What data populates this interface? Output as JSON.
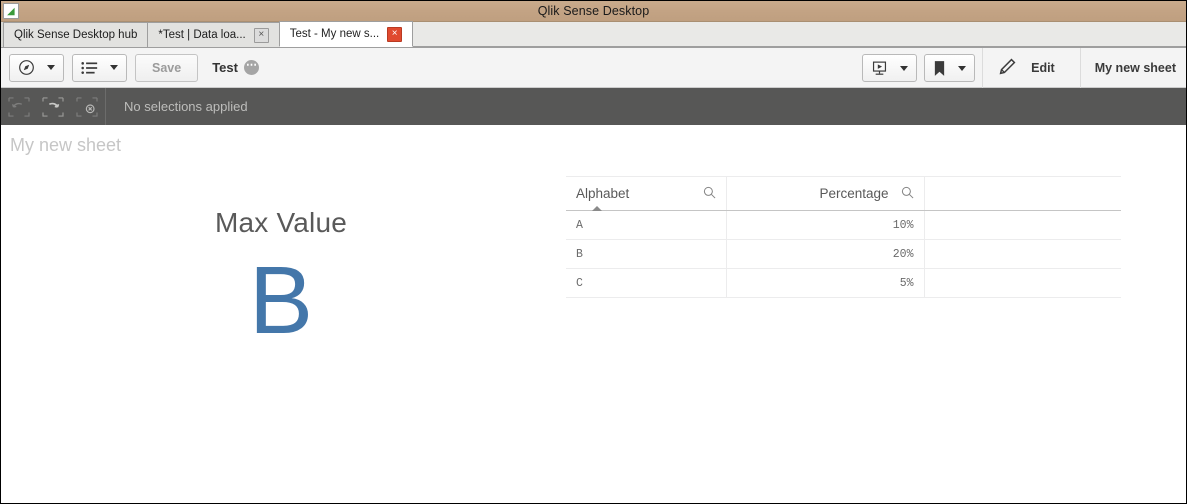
{
  "window": {
    "title": "Qlik Sense Desktop",
    "app_icon": "qlik-leaf-icon"
  },
  "tabs": [
    {
      "label": "Qlik Sense Desktop hub",
      "active": false,
      "closable": false
    },
    {
      "label": "*Test | Data loa...",
      "active": false,
      "closable": true,
      "close_label": "×"
    },
    {
      "label": "Test - My new s...",
      "active": true,
      "closable": true,
      "close_label": "×"
    }
  ],
  "toolbar": {
    "nav_button": {
      "icon": "compass-navigation-icon",
      "caret": "chevron-down-icon"
    },
    "sheets_button": {
      "icon": "sheet-list-icon",
      "caret": "chevron-down-icon"
    },
    "save_label": "Save",
    "app_name": "Test",
    "app_menu_icon": "ellipsis-circle-icon",
    "story_button": {
      "icon": "storytelling-icon",
      "caret": "chevron-down-icon"
    },
    "bookmark_button": {
      "icon": "bookmark-icon",
      "caret": "chevron-down-icon"
    },
    "edit_label": "Edit",
    "edit_icon": "pencil-icon",
    "sheet_name_label": "My new sheet"
  },
  "selections_bar": {
    "status_text": "No selections applied",
    "back_icon": "selection-step-back-icon",
    "forward_icon": "selection-step-forward-icon",
    "clear_icon": "clear-all-selections-icon"
  },
  "sheet": {
    "title": "My new sheet",
    "kpi": {
      "label": "Max Value",
      "value": "B",
      "value_color": "#4477aa"
    },
    "table": {
      "columns": [
        {
          "header": "Alphabet",
          "align": "left",
          "sorted": "asc",
          "search_icon": "search-icon"
        },
        {
          "header": "Percentage",
          "align": "right",
          "sorted": "none",
          "search_icon": "search-icon"
        },
        {
          "header": "",
          "align": "left",
          "sorted": "none",
          "search_icon": ""
        }
      ],
      "rows": [
        [
          "A",
          "10%",
          ""
        ],
        [
          "B",
          "20%",
          ""
        ],
        [
          "C",
          "5%",
          ""
        ]
      ]
    }
  },
  "colors": {
    "titlebar": "#c3a384",
    "selections_bar": "#575756",
    "accent_blue": "#4477aa",
    "close_red": "#e04a2f"
  }
}
